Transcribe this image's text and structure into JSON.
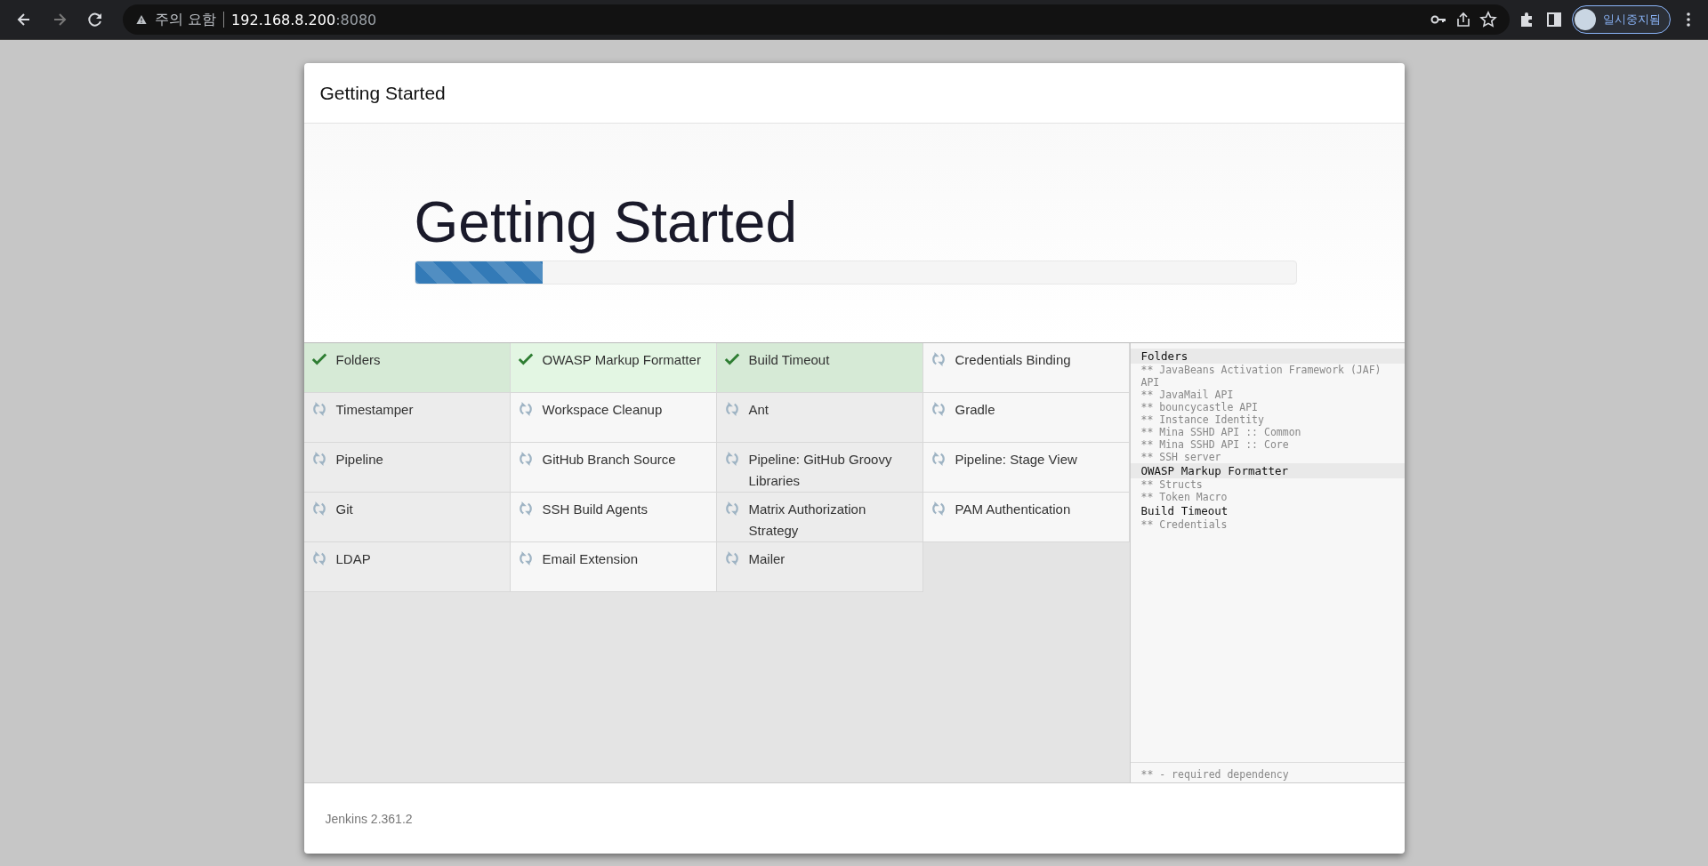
{
  "browser": {
    "warning": "주의 요함",
    "url_host": "192.168.8.200",
    "url_port": ":8080",
    "profile": "일시중지됨"
  },
  "dialog": {
    "title": "Getting Started",
    "heading": "Getting Started",
    "progress": {
      "level": 0.145
    },
    "plugins": [
      {
        "name": "Folders",
        "installed": true
      },
      {
        "name": "OWASP Markup Formatter",
        "installed": true
      },
      {
        "name": "Build Timeout",
        "installed": true
      },
      {
        "name": "Credentials Binding",
        "installed": false
      },
      {
        "name": "Timestamper",
        "installed": false
      },
      {
        "name": "Workspace Cleanup",
        "installed": false
      },
      {
        "name": "Ant",
        "installed": false
      },
      {
        "name": "Gradle",
        "installed": false
      },
      {
        "name": "Pipeline",
        "installed": false
      },
      {
        "name": "GitHub Branch Source",
        "installed": false
      },
      {
        "name": "Pipeline: GitHub Groovy Libraries",
        "installed": false
      },
      {
        "name": "Pipeline: Stage View",
        "installed": false
      },
      {
        "name": "Git",
        "installed": false
      },
      {
        "name": "SSH Build Agents",
        "installed": false
      },
      {
        "name": "Matrix Authorization Strategy",
        "installed": false
      },
      {
        "name": "PAM Authentication",
        "installed": false
      },
      {
        "name": "LDAP",
        "installed": false
      },
      {
        "name": "Email Extension",
        "installed": false
      },
      {
        "name": "Mailer",
        "installed": false
      }
    ],
    "log": [
      {
        "text": "Folders",
        "kind": "plugin",
        "highlighted": true
      },
      {
        "text": "** JavaBeans Activation Framework (JAF) API",
        "kind": "dependency",
        "highlighted": false
      },
      {
        "text": "** JavaMail API",
        "kind": "dependency",
        "highlighted": false
      },
      {
        "text": "** bouncycastle API",
        "kind": "dependency",
        "highlighted": false
      },
      {
        "text": "** Instance Identity",
        "kind": "dependency",
        "highlighted": false
      },
      {
        "text": "** Mina SSHD API :: Common",
        "kind": "dependency",
        "highlighted": false
      },
      {
        "text": "** Mina SSHD API :: Core",
        "kind": "dependency",
        "highlighted": false
      },
      {
        "text": "** SSH server",
        "kind": "dependency",
        "highlighted": false
      },
      {
        "text": "OWASP Markup Formatter",
        "kind": "plugin",
        "highlighted": true
      },
      {
        "text": "** Structs",
        "kind": "dependency",
        "highlighted": false
      },
      {
        "text": "** Token Macro",
        "kind": "dependency",
        "highlighted": false
      },
      {
        "text": "Build Timeout",
        "kind": "plugin",
        "highlighted": false
      },
      {
        "text": "** Credentials",
        "kind": "dependency",
        "highlighted": false
      }
    ],
    "legend": "** - required dependency",
    "footer": "Jenkins 2.361.2"
  }
}
